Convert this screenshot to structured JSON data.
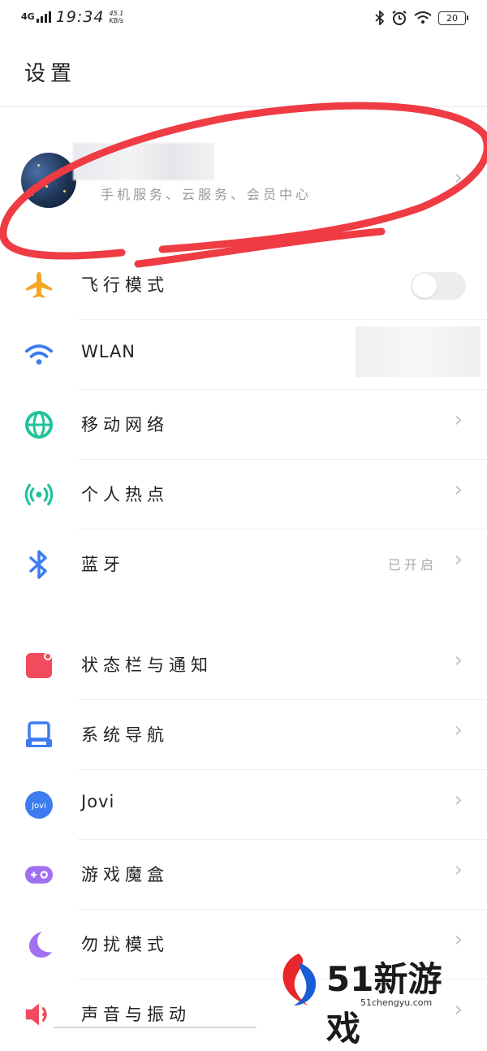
{
  "status_bar": {
    "network": "4G",
    "time": "19:34",
    "speed_value": "45.1",
    "speed_unit": "KB/s",
    "battery": "20"
  },
  "page_title": "设置",
  "account": {
    "subtitle": "手机服务、云服务、会员中心"
  },
  "rows": [
    {
      "label": "飞行模式",
      "icon": "airplane-icon",
      "color": "#F5A623",
      "control": "toggle",
      "toggle_on": false
    },
    {
      "label": "WLAN",
      "icon": "wifi-icon",
      "color": "#3D7CF0",
      "control": "none"
    },
    {
      "label": "移动网络",
      "icon": "globe-icon",
      "color": "#22C39A",
      "control": "chevron"
    },
    {
      "label": "个人热点",
      "icon": "hotspot-icon",
      "color": "#22C39A",
      "control": "chevron"
    },
    {
      "label": "蓝牙",
      "icon": "bluetooth-icon",
      "color": "#3D7CF0",
      "control": "chevron",
      "value": "已开启"
    },
    {
      "label": "状态栏与通知",
      "icon": "notification-icon",
      "color": "#F24B5E",
      "control": "chevron"
    },
    {
      "label": "系统导航",
      "icon": "navigation-icon",
      "color": "#3D7CF0",
      "control": "chevron"
    },
    {
      "label": "Jovi",
      "icon": "jovi-icon",
      "color": "#3D7CF0",
      "control": "chevron",
      "icon_text": "Jovi"
    },
    {
      "label": "游戏魔盒",
      "icon": "gamepad-icon",
      "color": "#A070EE",
      "control": "chevron"
    },
    {
      "label": "勿扰模式",
      "icon": "moon-icon",
      "color": "#A070EE",
      "control": "chevron"
    },
    {
      "label": "声音与振动",
      "icon": "speaker-icon",
      "color": "#F24B5E",
      "control": "chevron"
    }
  ],
  "watermark": {
    "brand": "51新游戏",
    "domain": "51chengyu.com"
  }
}
